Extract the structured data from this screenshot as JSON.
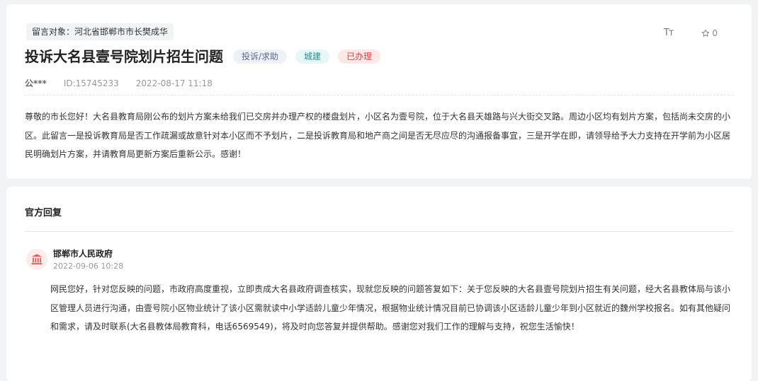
{
  "message": {
    "target_label": "留言对象：河北省邯郸市市长樊成华",
    "title": "投诉大名县壹号院划片招生问题",
    "tags": [
      "投诉/求助",
      "城建",
      "已办理"
    ],
    "user": "公***",
    "id_text": "ID:15745233",
    "datetime": "2022-08-17 11:18",
    "font_toggle": "Tт",
    "star_count": "0",
    "content": "尊敬的市长您好！大名县教育局刚公布的划片方案未给我们已交房并办理产权的楼盘划片，小区名为壹号院，位于大名县天雄路与兴大街交叉路。周边小区均有划片方案，包括尚未交房的小区。此留言一是投诉教育局是否工作疏漏或故意针对本小区而不予划片，二是投诉教育局和地产商之间是否无尽应尽的沟通报备事宜，三是开学在即，请领导给予大力支持在开学前为小区居民明确划片方案，并请教育局更新方案后重新公示。感谢！"
  },
  "reply": {
    "section_title": "官方回复",
    "org_name": "邯郸市人民政府",
    "datetime": "2022-09-06 10:28",
    "content": "网民您好，针对您反映的问题，市政府高度重视，立即责成大名县政府调查核实，现就您反映的问题答复如下：关于您反映的大名县壹号院划片招生有关问题，经大名县教体局与该小区管理人员进行沟通，由壹号院小区物业统计了该小区需就读中小学适龄儿童少年情况，根据物业统计情况目前已协调该小区适龄儿童少年到小区就近的魏州学校报名。如有其他疑问和需求，请及时联系(大名县教体局教育科，电话6569549)，将及时向您答复并提供帮助。感谢您对我们工作的理解与支持，祝您生活愉快！"
  },
  "icons": {
    "star": "star-icon",
    "org": "government-building-icon",
    "font": "font-size-icon"
  },
  "colors": {
    "tag_status": "#d94040",
    "tag_city": "#2a8f8f",
    "org_icon": "#e05a5a"
  }
}
